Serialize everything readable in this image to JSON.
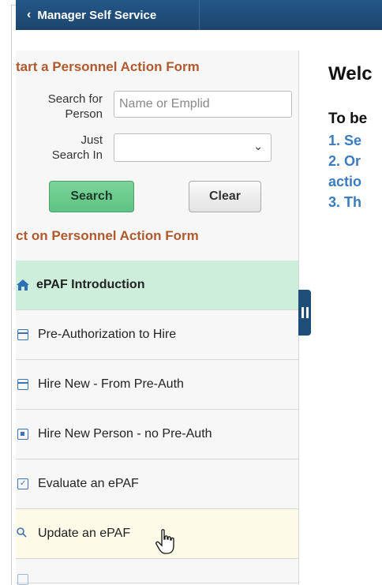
{
  "header": {
    "back_label": "Manager Self Service"
  },
  "start_form": {
    "heading": "tart a Personnel Action Form",
    "search_for_label_1": "Search for",
    "search_for_label_2": "Person",
    "search_placeholder": "Name or Emplid",
    "just_search_label_1": "Just",
    "just_search_label_2": "Search In",
    "search_button": "Search",
    "clear_button": "Clear"
  },
  "act_on": {
    "heading": "ct on Personnel Action Form",
    "items": [
      {
        "label": "ePAF Introduction",
        "icon": "home-icon",
        "state": "active"
      },
      {
        "label": "Pre-Authorization to Hire",
        "icon": "form-icon",
        "state": "normal"
      },
      {
        "label": "Hire New - From Pre-Auth",
        "icon": "form-icon",
        "state": "normal"
      },
      {
        "label": "Hire New Person - no Pre-Auth",
        "icon": "new-form-icon",
        "state": "normal"
      },
      {
        "label": "Evaluate an ePAF",
        "icon": "evaluate-icon",
        "state": "normal"
      },
      {
        "label": "Update an ePAF",
        "icon": "search-icon",
        "state": "hover"
      }
    ]
  },
  "main": {
    "title": "Welc",
    "intro": "To be",
    "steps": [
      "1. Se",
      "2. Or",
      "actio",
      "3. Th"
    ]
  },
  "colors": {
    "header_bg": "#1f4e79",
    "section_heading": "#b0592d",
    "link_blue": "#3b7bbf",
    "active_item_bg": "#cdeedb",
    "search_button_bg": "#6dcb8e"
  }
}
